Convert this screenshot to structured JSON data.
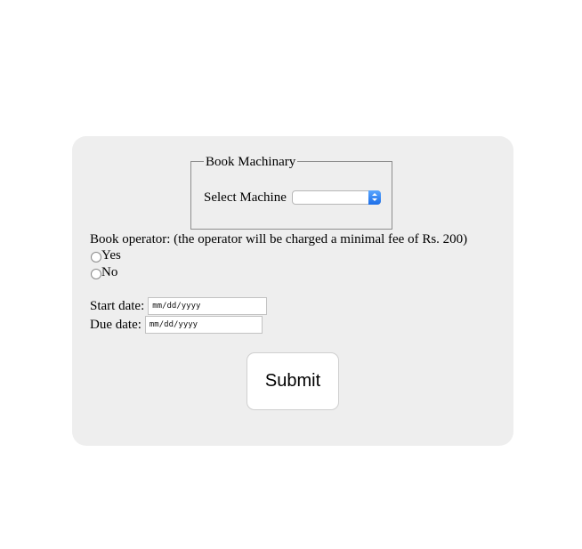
{
  "form": {
    "legend": "Book Machinary",
    "select_label": "Select Machine",
    "select_value": "",
    "operator_label": "Book operator: (the operator will be charged a minimal fee of Rs. 200)",
    "radio_yes": "Yes",
    "radio_no": "No",
    "start_label": "Start date:",
    "start_placeholder": "mm/dd/yyyy",
    "due_label": "Due date:",
    "due_placeholder": "mm/dd/yyyy",
    "submit_label": "Submit"
  },
  "colors": {
    "card_bg": "#eeeeee",
    "select_accent": "#1c6ee8"
  }
}
